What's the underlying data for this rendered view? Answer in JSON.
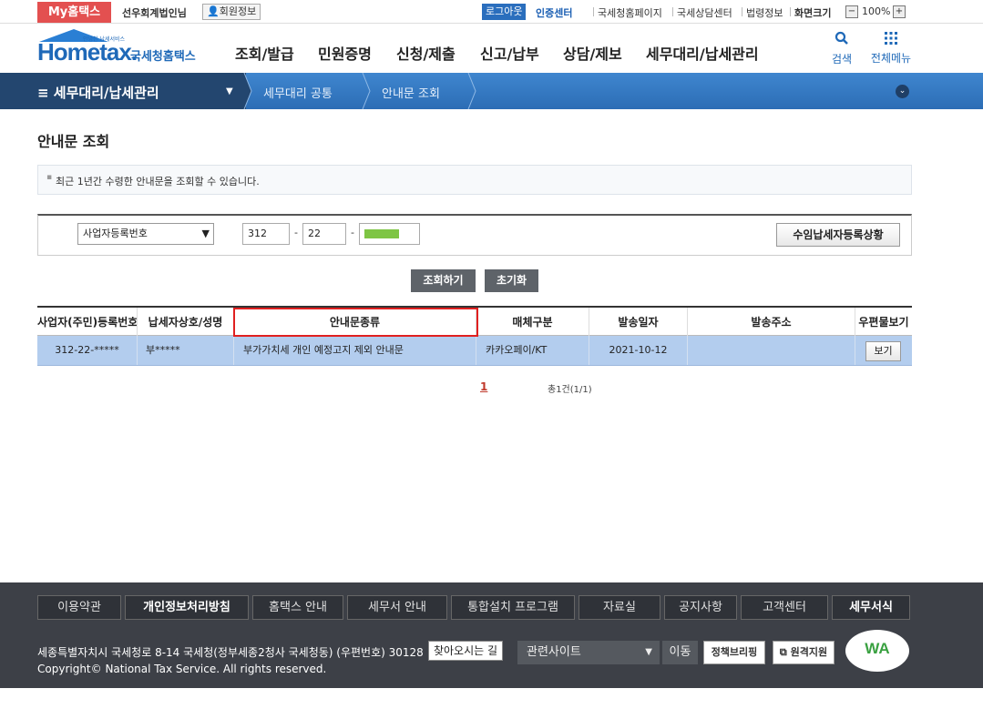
{
  "topbar": {
    "my_label": "My홈택스",
    "user_name": "선우회계법인님",
    "member_info": "회원정보",
    "logout": "로그아웃",
    "cert_center": "인증센터",
    "links": [
      "국세청홈페이지",
      "국세상담센터",
      "법령정보",
      "화면크기"
    ],
    "zoom_minus": "−",
    "zoom_value": "100%",
    "zoom_plus": "+"
  },
  "header": {
    "logo_tiny": "안녕한 납세서비스",
    "logo_main": "Hometax.",
    "logo_sub": "국세청홈택스",
    "nav": [
      "조회/발급",
      "민원증명",
      "신청/제출",
      "신고/납부",
      "상담/제보",
      "세무대리/납세관리"
    ],
    "search_label": "검색",
    "allmenu_label": "전체메뉴"
  },
  "breadcrumb": {
    "section": "세무대리/납세관리",
    "items": [
      "세무대리 공통",
      "안내문 조회"
    ]
  },
  "main": {
    "title": "안내문 조회",
    "notice": "최근 1년간 수령한 안내문을 조회할 수 있습니다.",
    "search": {
      "select_value": "사업자등록번호",
      "biz_no_1": "312",
      "biz_no_2": "22",
      "dash": "-",
      "register_button": "수임납세자등록상황"
    },
    "search_button": "조회하기",
    "reset_button": "초기화",
    "table": {
      "headers": [
        "사업자(주민)등록번호",
        "납세자상호/성명",
        "안내문종류",
        "매체구분",
        "발송일자",
        "발송주소",
        "우편물보기"
      ],
      "rows": [
        {
          "biz_no": "312-22-*****",
          "name": "부*****",
          "notice_type": "부가가치세 개인 예정고지 제외 안내문",
          "media": "카카오페이/KT",
          "date": "2021-10-12",
          "address": "",
          "view": "보기"
        }
      ]
    },
    "pagination": {
      "page": "1",
      "total": "총1건(1/1)"
    }
  },
  "footer": {
    "links": [
      "이용약관",
      "개인정보처리방침",
      "홈택스 안내",
      "세무서 안내",
      "통합설치 프로그램",
      "자료실",
      "공지사항",
      "고객센터",
      "세무서식"
    ],
    "address": "세종특별자치시 국세청로 8-14 국세청(정부세종2청사 국세청동) (우편번호) 30128",
    "find_way": "찾아오시는 길",
    "copyright": "Copyright© National Tax Service. All rights reserved.",
    "related_sites": "관련사이트",
    "move": "이동",
    "briefing": "정책브리핑",
    "remote": "원격지원",
    "wa_mark": "WA"
  },
  "colors": {
    "accent": "#1f69b8",
    "my_red": "#e35050",
    "row_highlight": "#b3cdee",
    "outline_red": "#e02020"
  }
}
